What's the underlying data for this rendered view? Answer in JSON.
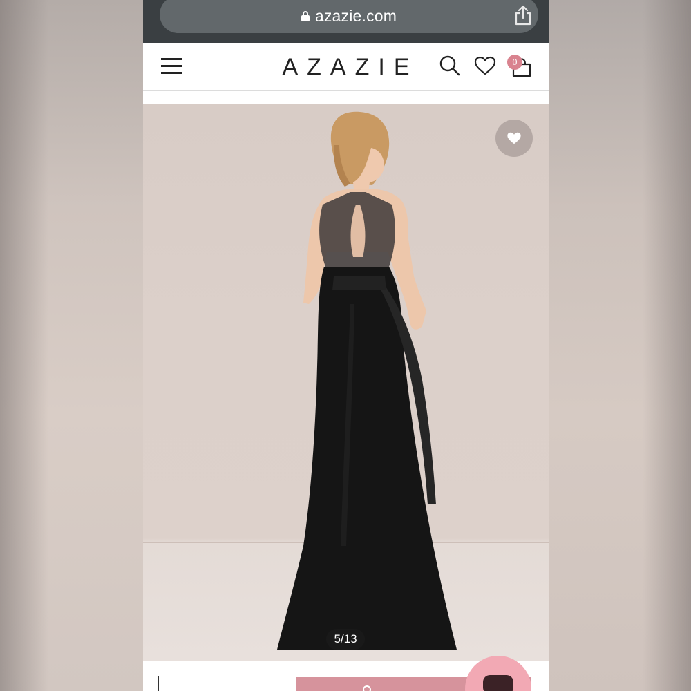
{
  "browser": {
    "url": "azazie.com"
  },
  "header": {
    "logo": "AZAZIE",
    "cart_count": "0"
  },
  "gallery": {
    "counter": "5/13",
    "image_alt": "Woman in a long black halter chiffon gown, back view"
  },
  "colors": {
    "brand_pink": "#d6939c",
    "badge_pink": "#d9838f",
    "chat_pink": "#f2a9b4"
  },
  "icons": [
    "lock-icon",
    "share-icon",
    "menu-icon",
    "search-icon",
    "heart-icon",
    "bag-icon",
    "location-icon",
    "chat-icon"
  ]
}
